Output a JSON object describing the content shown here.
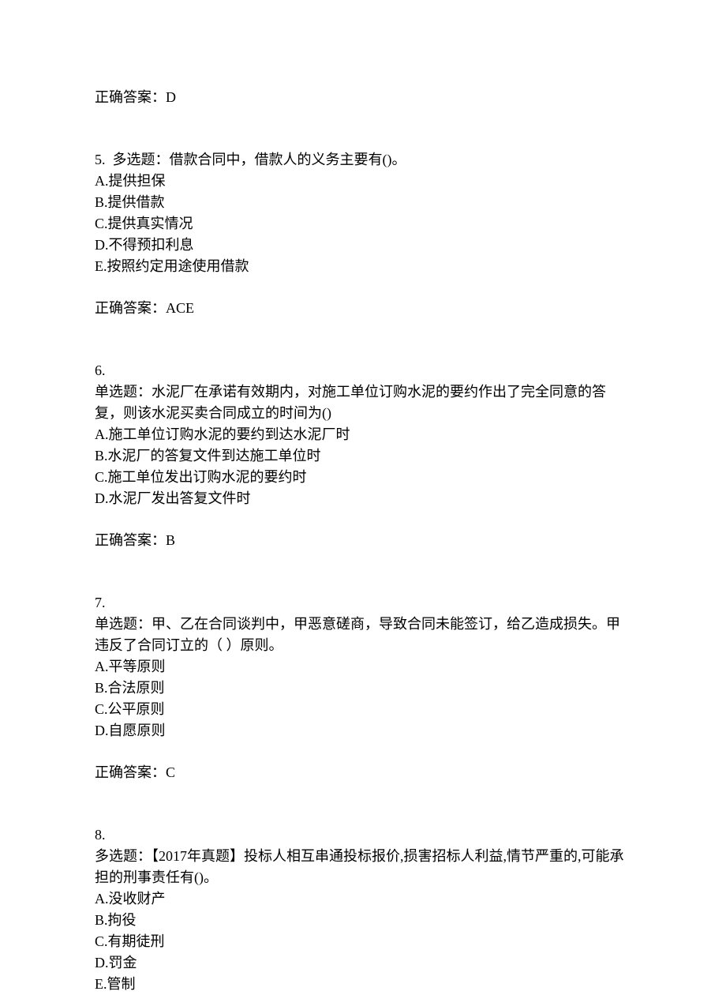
{
  "q4": {
    "answer_label": "正确答案：D"
  },
  "q5": {
    "header": "5.  多选题：借款合同中，借款人的义务主要有()。",
    "options": {
      "a": "A.提供担保",
      "b": "B.提供借款",
      "c": "C.提供真实情况",
      "d": "D.不得预扣利息",
      "e": "E.按照约定用途使用借款"
    },
    "answer_label": "正确答案：ACE"
  },
  "q6": {
    "num": "6.",
    "header": "单选题：水泥厂在承诺有效期内，对施工单位订购水泥的要约作出了完全同意的答复，则该水泥买卖合同成立的时间为()",
    "options": {
      "a": "A.施工单位订购水泥的要约到达水泥厂时",
      "b": "B.水泥厂的答复文件到达施工单位时",
      "c": "C.施工单位发出订购水泥的要约时",
      "d": "D.水泥厂发出答复文件时"
    },
    "answer_label": "正确答案：B"
  },
  "q7": {
    "num": "7.",
    "header": "单选题：甲、乙在合同谈判中，甲恶意磋商，导致合同未能签订，给乙造成损失。甲违反了合同订立的（ ）原则。",
    "options": {
      "a": "A.平等原则",
      "b": "B.合法原则",
      "c": "C.公平原则",
      "d": "D.自愿原则"
    },
    "answer_label": "正确答案：C"
  },
  "q8": {
    "num": "8.",
    "header": "多选题：【2017年真题】投标人相互串通投标报价,损害招标人利益,情节严重的,可能承担的刑事责任有()。",
    "options": {
      "a": "A.没收财产",
      "b": "B.拘役",
      "c": "C.有期徒刑",
      "d": "D.罚金",
      "e": "E.管制"
    }
  }
}
